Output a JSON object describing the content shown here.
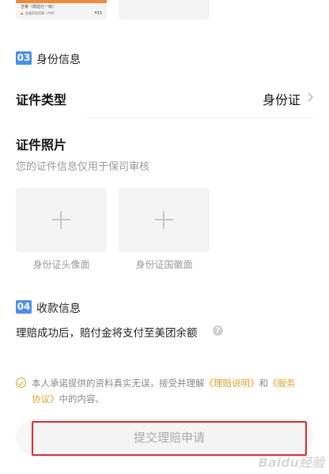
{
  "top_photo": {
    "line1": "吉莱（顺延社一级）",
    "line2": "金盛养殖莲康（中杯）",
    "price": "¥15"
  },
  "identity_section": {
    "number": "03",
    "title": "身份信息",
    "id_type_label": "证件类型",
    "id_type_value": "身份证",
    "photo_title": "证件照片",
    "photo_hint": "您的证件信息仅用于保司审核",
    "front_caption": "身份证头像面",
    "back_caption": "身份证国徽面"
  },
  "payment_section": {
    "number": "04",
    "title": "收款信息",
    "note": "理赔成功后，赔付金将支付至美团余额"
  },
  "agreement": {
    "prefix": "本人承诺提供的资料真实无误，接受并理解",
    "link1": "《理赔说明》",
    "and": "和",
    "link2_part1": "《服务",
    "link2_part2": "协议》",
    "suffix": "中的内容。"
  },
  "submit_label": "提交理赔申请",
  "watermark": "Baidu经验",
  "colors": {
    "badge": "#4a8ef0",
    "link": "#e0a030",
    "highlight_border": "#e8262a"
  }
}
